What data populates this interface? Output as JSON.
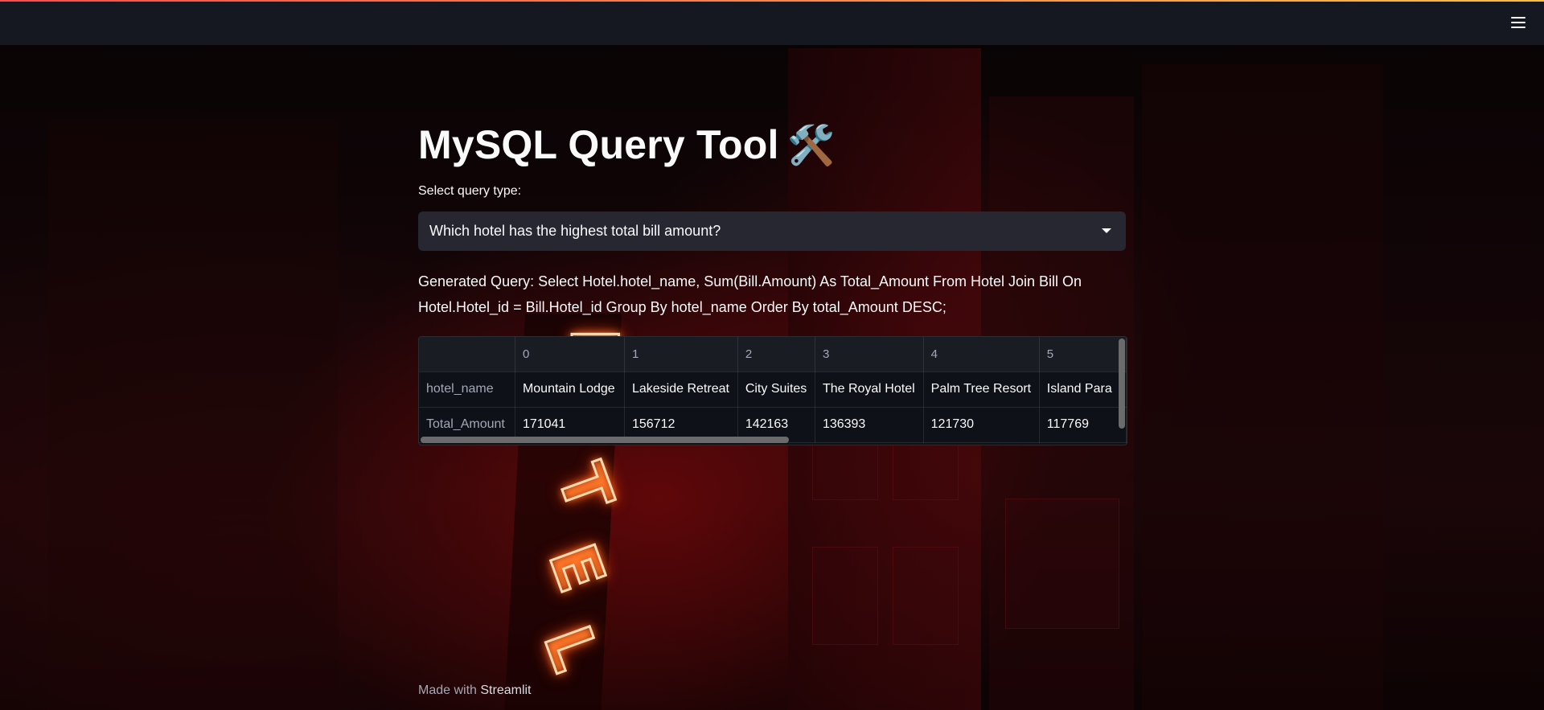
{
  "header": {
    "menu_icon": "hamburger-menu-icon"
  },
  "main": {
    "title": "MySQL Query Tool",
    "title_icon": "🛠️",
    "select_label": "Select query type:",
    "select_value": "Which hotel has the highest total bill amount?",
    "generated_query": "Generated Query: Select Hotel.hotel_name, Sum(Bill.Amount) As Total_Amount From Hotel Join Bill On Hotel.Hotel_id = Bill.Hotel_id Group By hotel_name Order By total_Amount DESC;"
  },
  "table": {
    "columns": [
      "",
      "0",
      "1",
      "2",
      "3",
      "4",
      "5"
    ],
    "rows": [
      {
        "label": "hotel_name",
        "cells": [
          "Mountain Lodge",
          "Lakeside Retreat",
          "City Suites",
          "The Royal Hotel",
          "Palm Tree Resort",
          "Island Para"
        ]
      },
      {
        "label": "Total_Amount",
        "cells": [
          "171041",
          "156712",
          "142163",
          "136393",
          "121730",
          "117769"
        ]
      }
    ]
  },
  "footer": {
    "prefix": "Made with",
    "brand": "Streamlit"
  },
  "colors": {
    "header_bg": "#161821",
    "select_bg": "#262730",
    "accent_gradient_start": "#ff4b4b",
    "accent_gradient_end": "#ffbd45"
  }
}
